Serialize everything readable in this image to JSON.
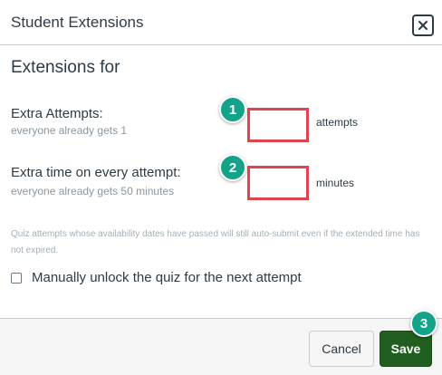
{
  "dialog": {
    "title": "Student Extensions",
    "close_icon": "close-icon"
  },
  "extensions": {
    "heading": "Extensions for",
    "extra_attempts": {
      "label": "Extra Attempts:",
      "hint": "everyone already gets 1",
      "value": "",
      "unit": "attempts",
      "badge": "1"
    },
    "extra_time": {
      "label": "Extra time on every attempt:",
      "hint": "everyone already gets 50 minutes",
      "value": "",
      "unit": "minutes",
      "badge": "2"
    },
    "note": "Quiz attempts whose availability dates have passed will still auto-submit even if the extended time has not expired.",
    "unlock_checkbox": {
      "label": "Manually unlock the quiz for the next attempt",
      "checked": false
    }
  },
  "footer": {
    "cancel_label": "Cancel",
    "save_label": "Save",
    "badge": "3"
  },
  "colors": {
    "badge": "#13a38a",
    "highlight": "#e0454d",
    "save_button": "#215e1f"
  }
}
